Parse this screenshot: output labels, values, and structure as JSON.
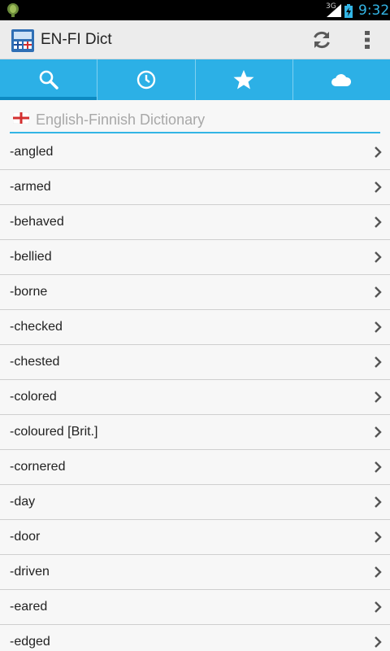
{
  "status_bar": {
    "network": "3G",
    "time": "9:32"
  },
  "app": {
    "title": "EN-FI Dict"
  },
  "icons": {
    "refresh": "refresh-icon",
    "overflow": "overflow-menu-icon",
    "search": "search-icon",
    "history": "clock-icon",
    "favorites": "star-icon",
    "cloud": "cloud-icon",
    "chevron": "chevron-right-icon"
  },
  "tabs": [
    {
      "name": "search",
      "active": true
    },
    {
      "name": "history",
      "active": false
    },
    {
      "name": "favorites",
      "active": false
    },
    {
      "name": "cloud",
      "active": false
    }
  ],
  "search": {
    "placeholder": "English-Finnish Dictionary",
    "value": ""
  },
  "words": [
    "-angled",
    "-armed",
    "-behaved",
    "-bellied",
    "-borne",
    "-checked",
    "-chested",
    "-colored",
    "-coloured [Brit.]",
    "-cornered",
    "-day",
    "-door",
    "-driven",
    "-eared",
    "-edged"
  ],
  "colors": {
    "accent": "#33b5e5",
    "tab_bar": "#2cb0e6",
    "status_time": "#33b5e5"
  }
}
